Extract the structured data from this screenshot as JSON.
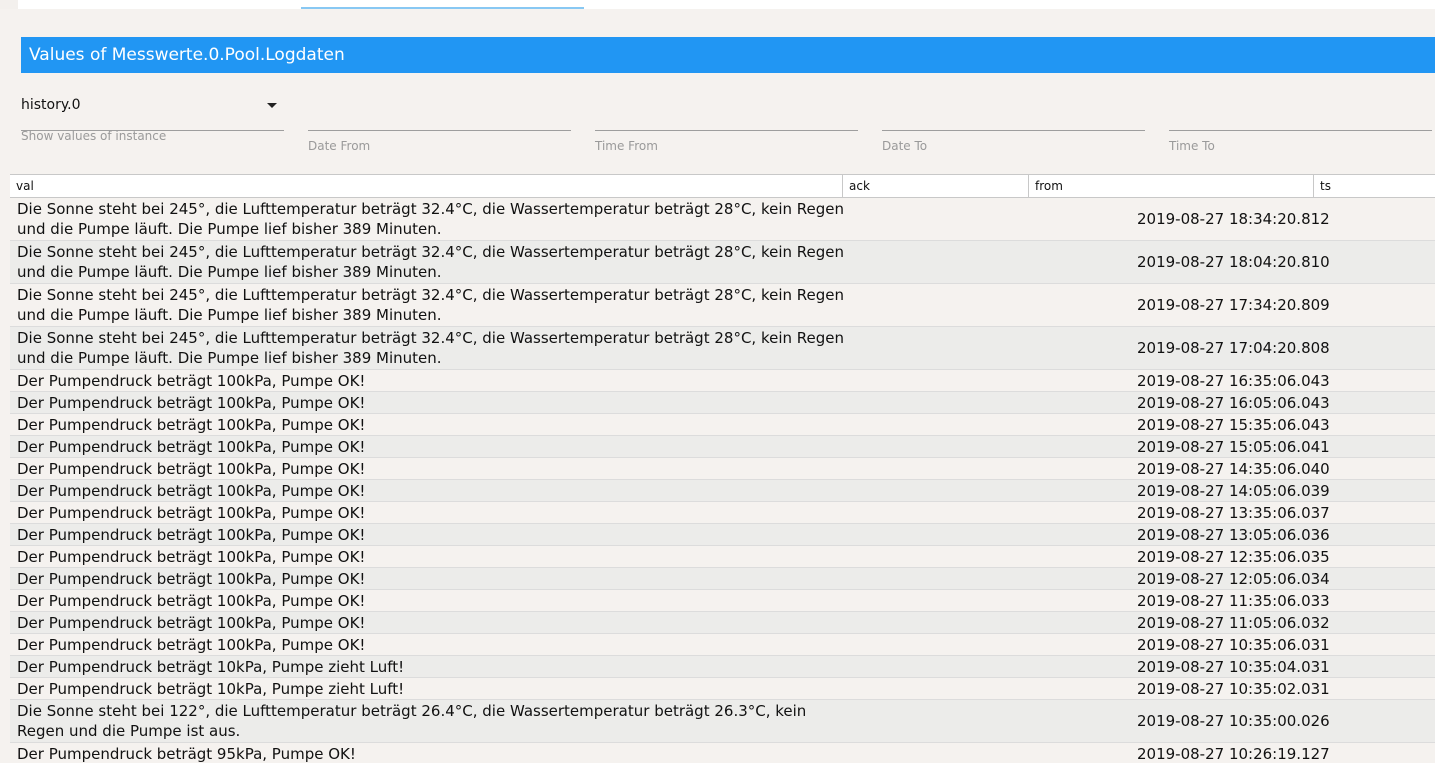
{
  "header": {
    "title": "Values of Messwerte.0.Pool.Logdaten"
  },
  "filters": {
    "instance_value": "history.0",
    "instance_helper": "Show values of instance",
    "date_from_label": "Date From",
    "time_from_label": "Time From",
    "date_to_label": "Date To",
    "time_to_label": "Time To"
  },
  "table": {
    "columns": [
      "val",
      "ack",
      "from",
      "ts"
    ],
    "rows": [
      {
        "val": "Die Sonne steht bei 245°, die Lufttemperatur beträgt 32.4°C, die Wassertemperatur beträgt 28°C, kein Regen und die Pumpe läuft. Die Pumpe lief bisher 389 Minuten.",
        "ts": "2019-08-27 18:34:20.812"
      },
      {
        "val": "Die Sonne steht bei 245°, die Lufttemperatur beträgt 32.4°C, die Wassertemperatur beträgt 28°C, kein Regen und die Pumpe läuft. Die Pumpe lief bisher 389 Minuten.",
        "ts": "2019-08-27 18:04:20.810"
      },
      {
        "val": "Die Sonne steht bei 245°, die Lufttemperatur beträgt 32.4°C, die Wassertemperatur beträgt 28°C, kein Regen und die Pumpe läuft. Die Pumpe lief bisher 389 Minuten.",
        "ts": "2019-08-27 17:34:20.809"
      },
      {
        "val": "Die Sonne steht bei 245°, die Lufttemperatur beträgt 32.4°C, die Wassertemperatur beträgt 28°C, kein Regen und die Pumpe läuft. Die Pumpe lief bisher 389 Minuten.",
        "ts": "2019-08-27 17:04:20.808"
      },
      {
        "val": "Der Pumpendruck beträgt 100kPa, Pumpe OK!",
        "ts": "2019-08-27 16:35:06.043"
      },
      {
        "val": "Der Pumpendruck beträgt 100kPa, Pumpe OK!",
        "ts": "2019-08-27 16:05:06.043"
      },
      {
        "val": "Der Pumpendruck beträgt 100kPa, Pumpe OK!",
        "ts": "2019-08-27 15:35:06.043"
      },
      {
        "val": "Der Pumpendruck beträgt 100kPa, Pumpe OK!",
        "ts": "2019-08-27 15:05:06.041"
      },
      {
        "val": "Der Pumpendruck beträgt 100kPa, Pumpe OK!",
        "ts": "2019-08-27 14:35:06.040"
      },
      {
        "val": "Der Pumpendruck beträgt 100kPa, Pumpe OK!",
        "ts": "2019-08-27 14:05:06.039"
      },
      {
        "val": "Der Pumpendruck beträgt 100kPa, Pumpe OK!",
        "ts": "2019-08-27 13:35:06.037"
      },
      {
        "val": "Der Pumpendruck beträgt 100kPa, Pumpe OK!",
        "ts": "2019-08-27 13:05:06.036"
      },
      {
        "val": "Der Pumpendruck beträgt 100kPa, Pumpe OK!",
        "ts": "2019-08-27 12:35:06.035"
      },
      {
        "val": "Der Pumpendruck beträgt 100kPa, Pumpe OK!",
        "ts": "2019-08-27 12:05:06.034"
      },
      {
        "val": "Der Pumpendruck beträgt 100kPa, Pumpe OK!",
        "ts": "2019-08-27 11:35:06.033"
      },
      {
        "val": "Der Pumpendruck beträgt 100kPa, Pumpe OK!",
        "ts": "2019-08-27 11:05:06.032"
      },
      {
        "val": "Der Pumpendruck beträgt 100kPa, Pumpe OK!",
        "ts": "2019-08-27 10:35:06.031"
      },
      {
        "val": "Der Pumpendruck beträgt 10kPa, Pumpe zieht Luft!",
        "ts": "2019-08-27 10:35:04.031"
      },
      {
        "val": "Der Pumpendruck beträgt 10kPa, Pumpe zieht Luft!",
        "ts": "2019-08-27 10:35:02.031"
      },
      {
        "val": "Die Sonne steht bei 122°, die Lufttemperatur beträgt 26.4°C, die Wassertemperatur beträgt 26.3°C, kein Regen und die Pumpe ist aus.",
        "ts": "2019-08-27 10:35:00.026"
      },
      {
        "val": "Der Pumpendruck beträgt 95kPa, Pumpe OK!",
        "ts": "2019-08-27 10:26:19.127"
      }
    ]
  }
}
